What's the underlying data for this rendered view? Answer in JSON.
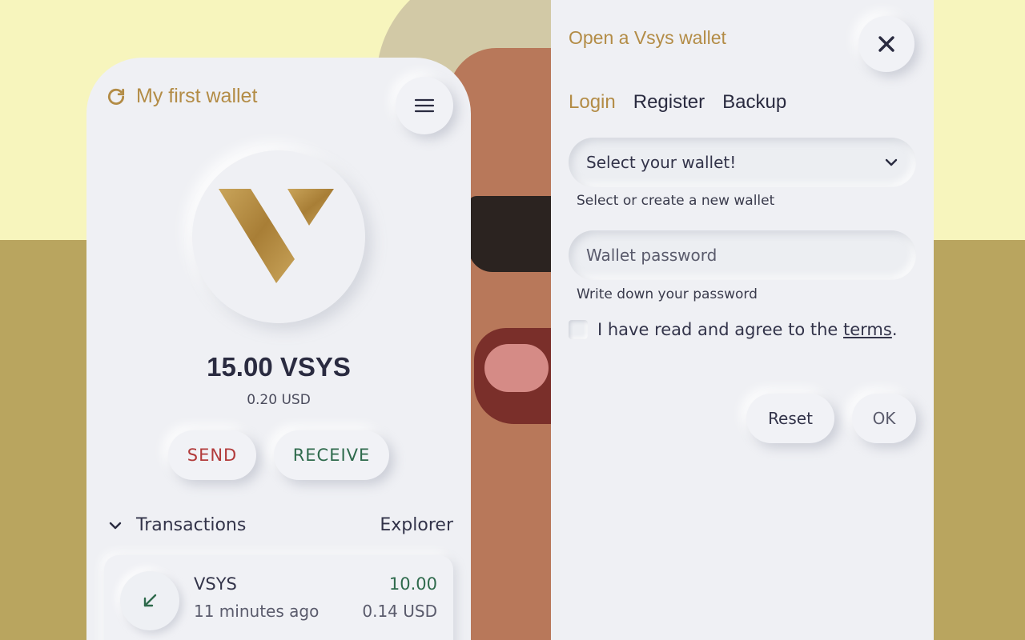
{
  "colors": {
    "accent": "#b38c46",
    "send": "#b23b3b",
    "receive": "#2e6a4c",
    "text": "#2a2b40",
    "panel": "#eff0f4"
  },
  "wallet": {
    "name": "My first wallet",
    "refresh_icon": "refresh-icon",
    "menu_icon": "hamburger-menu-icon",
    "logo": "vipertech-v-logo",
    "balance": "15.00 VSYS",
    "balance_usd": "0.20 USD",
    "send_label": "SEND",
    "receive_label": "RECEIVE",
    "transactions_label": "Transactions",
    "explorer_label": "Explorer",
    "transactions": [
      {
        "asset": "VSYS",
        "time": "11 minutes ago",
        "amount": "10.00",
        "usd": "0.14 USD",
        "direction_icon": "arrow-down-left-icon"
      }
    ]
  },
  "dialog": {
    "title": "Open a Vsys wallet",
    "close_icon": "close-icon",
    "tabs": [
      {
        "label": "Login",
        "active": true
      },
      {
        "label": "Register",
        "active": false
      },
      {
        "label": "Backup",
        "active": false
      }
    ],
    "wallet_select": {
      "value": "Select your wallet!",
      "hint": "Select or create a new wallet"
    },
    "password": {
      "placeholder": "Wallet password",
      "hint": "Write down your password"
    },
    "agree_text": "I have read and agree to the ",
    "terms_link": "terms",
    "agree_suffix": ".",
    "reset_label": "Reset",
    "ok_label": "OK"
  }
}
